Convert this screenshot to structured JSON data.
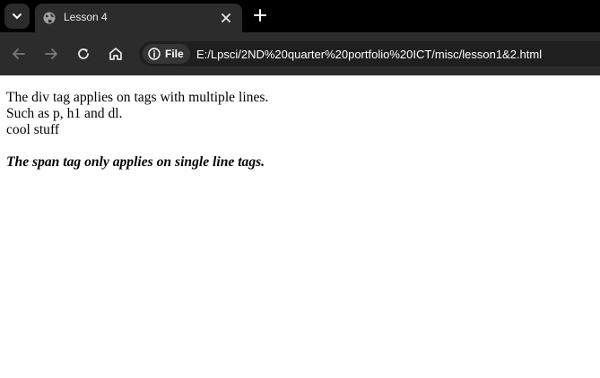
{
  "browser": {
    "tab": {
      "title": "Lesson 4",
      "favicon": "globe-icon"
    },
    "address_bar": {
      "scheme_chip": "File",
      "url": "E:/Lpsci/2ND%20quarter%20portfolio%20ICT/misc/lesson1&2.html"
    },
    "toolbar_icons": [
      "back-icon",
      "forward-icon",
      "reload-icon",
      "home-icon"
    ]
  },
  "page": {
    "lines": [
      "The div tag applies on tags with multiple lines.",
      "Such as p, h1 and dl.",
      "cool stuff"
    ],
    "span_text": "The span tag only applies on single line tags."
  }
}
